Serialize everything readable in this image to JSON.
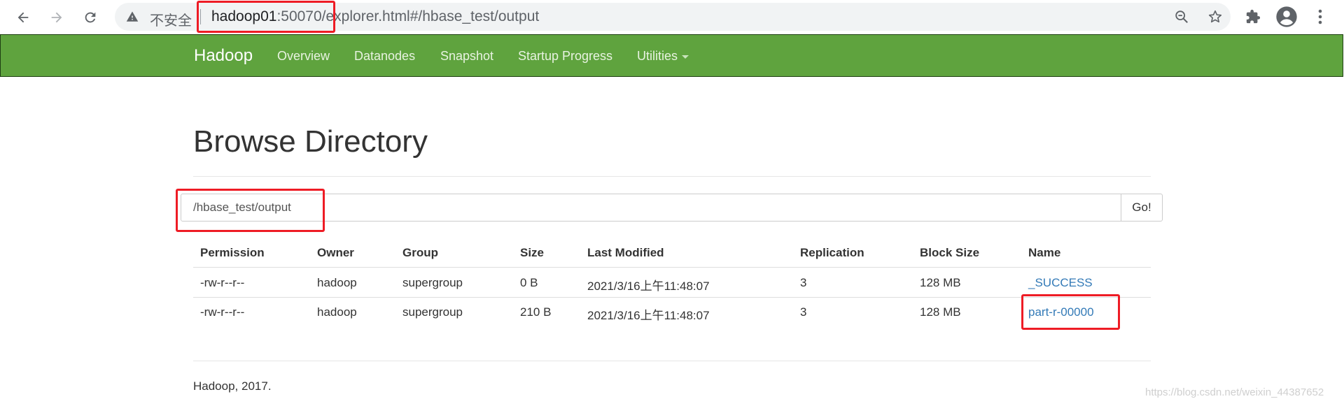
{
  "browser": {
    "back_icon": "arrow-left-icon",
    "forward_icon": "arrow-right-icon",
    "reload_icon": "reload-icon",
    "security_icon": "warning-triangle-icon",
    "security_label": "不安全",
    "url_host": "hadoop01",
    "url_port": ":50070",
    "url_path": "/explorer.html#/hbase_test/output",
    "zoom_icon": "zoom-out-icon",
    "bookmark_icon": "star-icon",
    "extensions_icon": "puzzle-icon",
    "profile_icon": "account-icon",
    "menu_icon": "kebab-menu-icon"
  },
  "navbar": {
    "brand": "Hadoop",
    "items": [
      "Overview",
      "Datanodes",
      "Snapshot",
      "Startup Progress",
      "Utilities"
    ],
    "color": "#5fa33e"
  },
  "page": {
    "title": "Browse Directory",
    "directory_value": "/hbase_test/output",
    "go_label": "Go!"
  },
  "table": {
    "headers": [
      "Permission",
      "Owner",
      "Group",
      "Size",
      "Last Modified",
      "Replication",
      "Block Size",
      "Name"
    ],
    "rows": [
      [
        "-rw-r--r--",
        "hadoop",
        "supergroup",
        "0 B",
        "2021/3/16上午11:48:07",
        "3",
        "128 MB",
        "_SUCCESS"
      ],
      [
        "-rw-r--r--",
        "hadoop",
        "supergroup",
        "210 B",
        "2021/3/16上午11:48:07",
        "3",
        "128 MB",
        "part-r-00000"
      ]
    ]
  },
  "footer": {
    "text": "Hadoop, 2017."
  },
  "watermark": "https://blog.csdn.net/weixin_44387652",
  "colors": {
    "annotation": "#ee1c25",
    "link": "#337ab7"
  }
}
